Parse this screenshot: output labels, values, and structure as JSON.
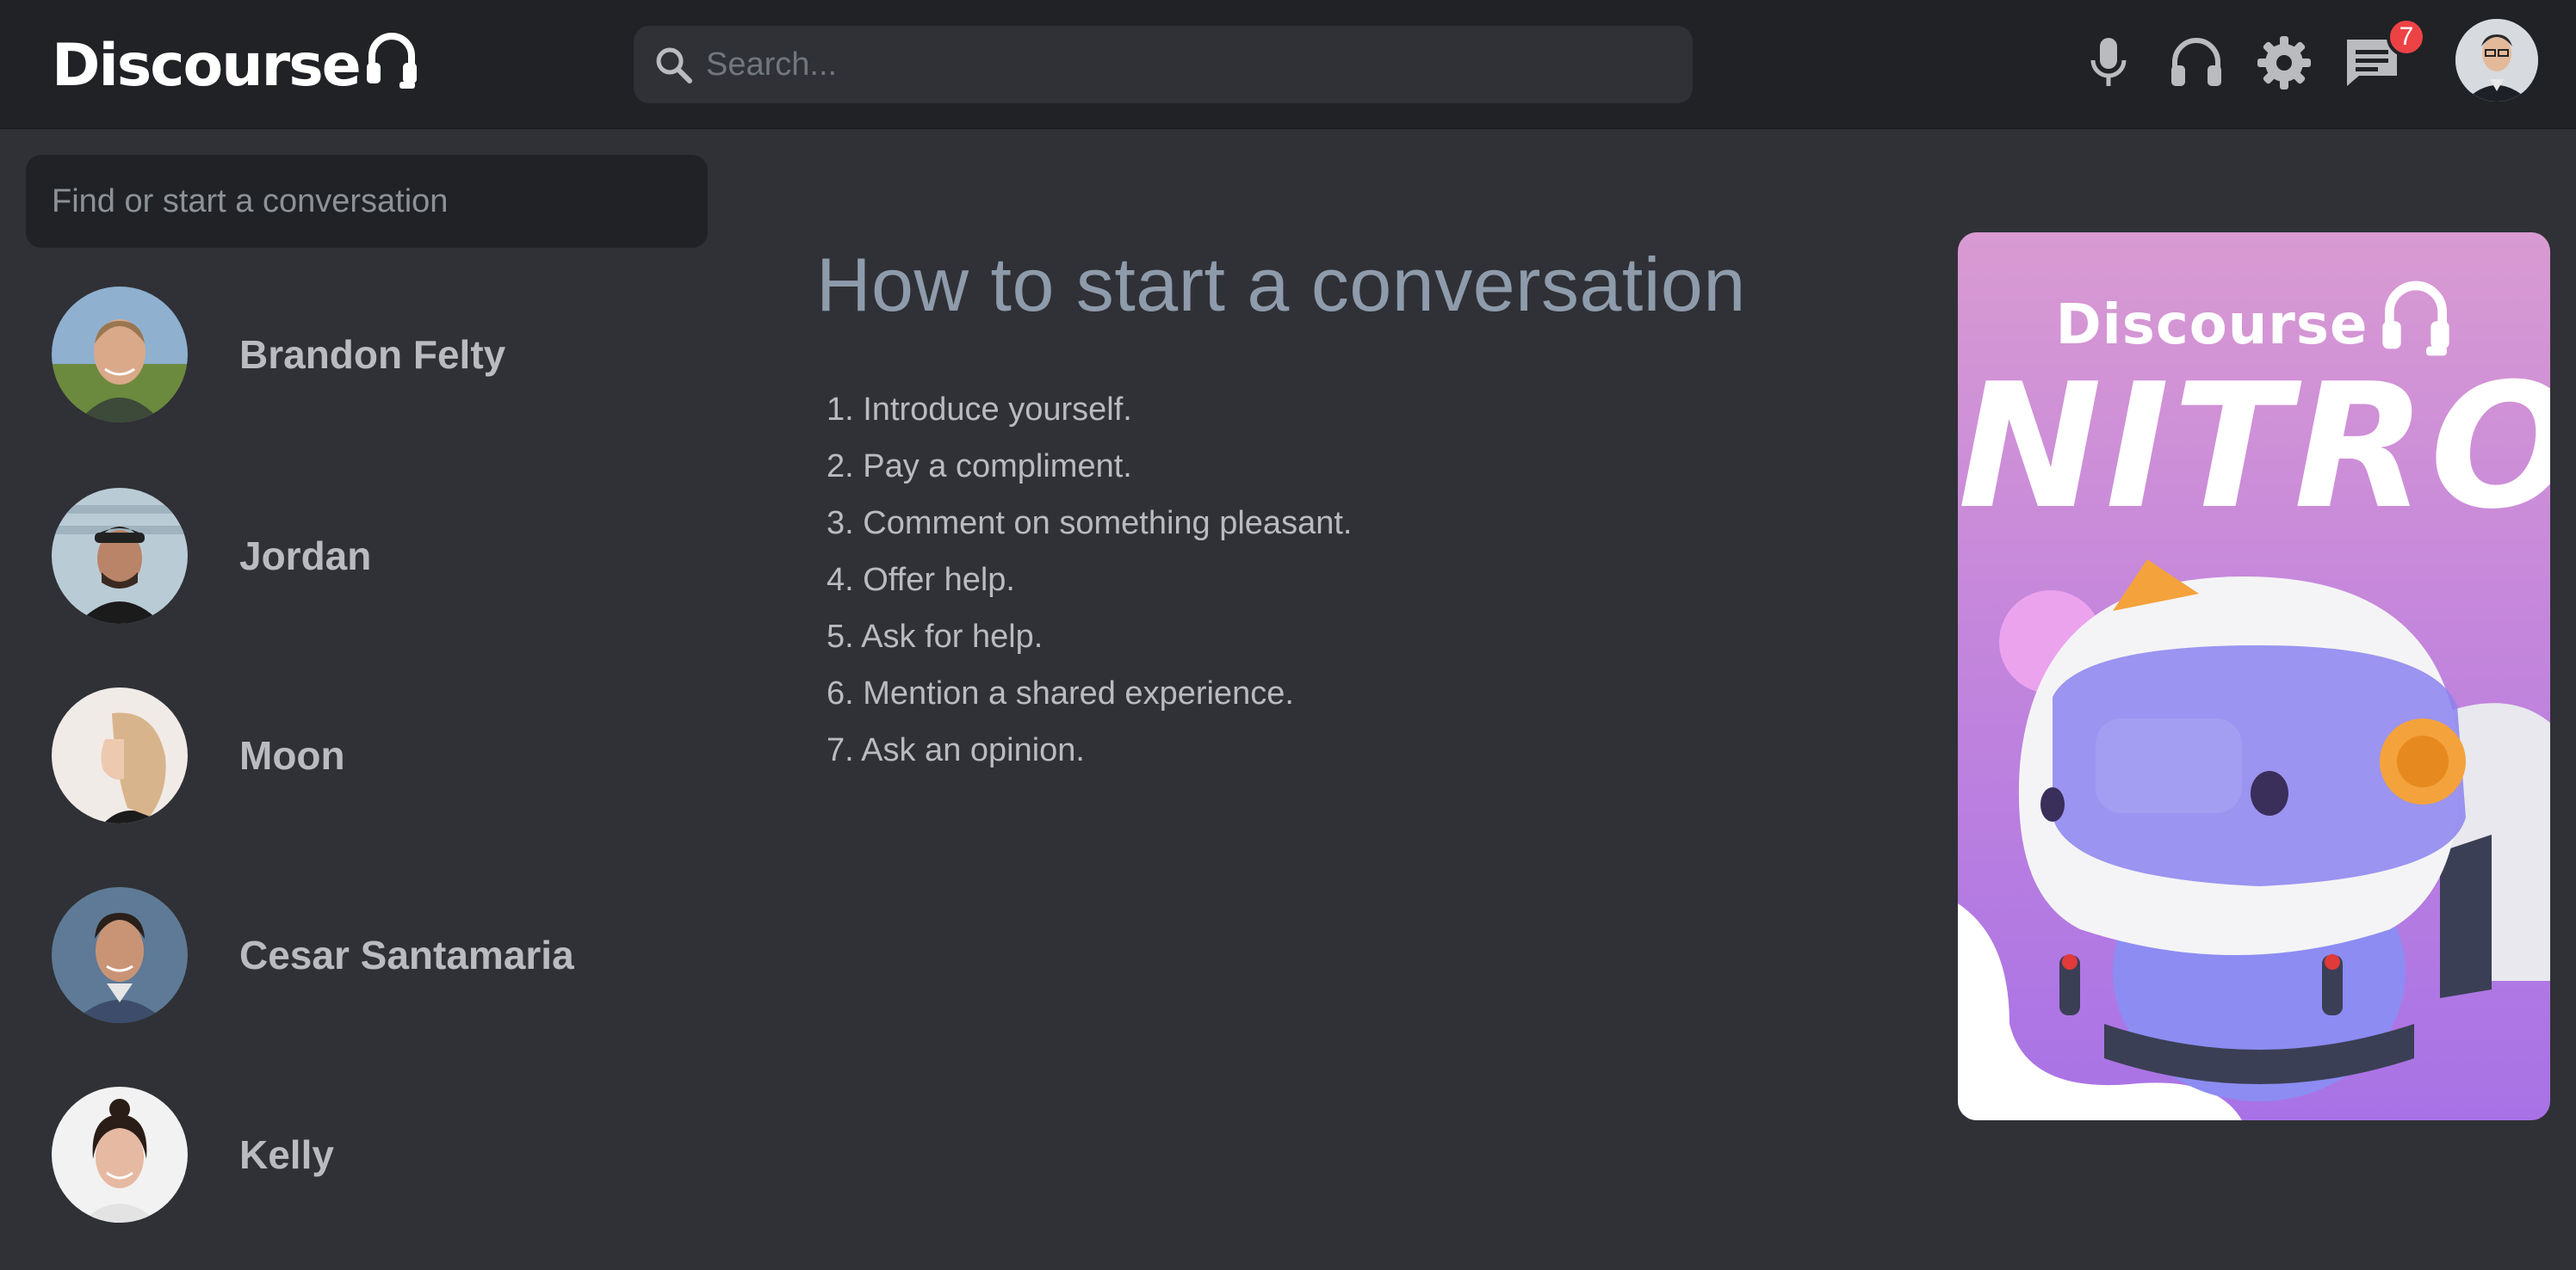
{
  "header": {
    "brand": "Discourse",
    "brand_icon": "headset-icon",
    "search_placeholder": "Search...",
    "icons": [
      "microphone-icon",
      "headphones-icon",
      "gear-icon",
      "chat-icon"
    ],
    "notification_count": "7"
  },
  "sidebar": {
    "find_placeholder": "Find or start a conversation",
    "conversations": [
      {
        "name": "Brandon Felty"
      },
      {
        "name": "Jordan"
      },
      {
        "name": "Moon"
      },
      {
        "name": "Cesar Santamaria"
      },
      {
        "name": "Kelly"
      }
    ]
  },
  "main": {
    "title": "How to start a conversation",
    "tips": [
      "1. Introduce yourself.",
      "2. Pay a compliment.",
      "3. Comment on something pleasant.",
      "4. Offer help.",
      "5. Ask for help.",
      "6. Mention a shared experience.",
      "7. Ask an opinion."
    ]
  },
  "promo": {
    "brand": "Discourse",
    "headline": "NITRO"
  },
  "colors": {
    "topbar": "#202225",
    "background": "#2f3136",
    "badge": "#ed4245",
    "promo_gradient_top": "#d99ad2",
    "promo_gradient_bottom": "#a872e6"
  }
}
